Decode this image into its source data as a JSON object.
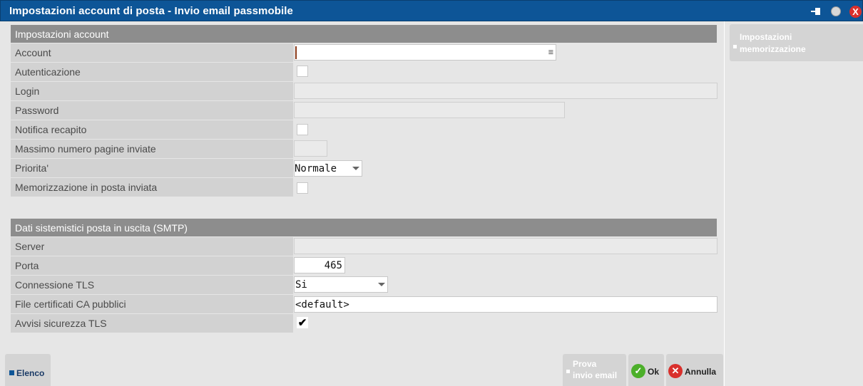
{
  "window": {
    "title": "Impostazioni account di posta - Invio email passmobile",
    "close_glyph": "X"
  },
  "section_account": {
    "title": "Impostazioni account",
    "account_label": "Account",
    "account_value": "",
    "account_menu_glyph": "≡",
    "autenticazione_label": "Autenticazione",
    "autenticazione_checked": false,
    "login_label": "Login",
    "login_value": "",
    "password_label": "Password",
    "password_value": "",
    "notifica_label": "Notifica recapito",
    "notifica_checked": false,
    "massimo_label": "Massimo numero pagine inviate",
    "massimo_value": "",
    "priorita_label": "Priorita'",
    "priorita_value": "Normale",
    "memorizzazione_label": "Memorizzazione in posta inviata",
    "memorizzazione_checked": false
  },
  "section_smtp": {
    "title": "Dati sistemistici posta in uscita (SMTP)",
    "server_label": "Server",
    "server_value": "",
    "porta_label": "Porta",
    "porta_value": "465",
    "tls_label": "Connessione TLS",
    "tls_value": "Si",
    "certificati_label": "File certificati CA pubblici",
    "certificati_value": "<default>",
    "avvisi_label": "Avvisi sicurezza TLS",
    "avvisi_glyph": "✔"
  },
  "sidebar": {
    "impostazioni_line1": "Impostazioni",
    "impostazioni_line2": "memorizzazione"
  },
  "bottom_bar": {
    "elenco_label": "Elenco",
    "prova_line1": "Prova",
    "prova_line2": "invio email",
    "ok_label": "Ok",
    "ok_glyph": "✓",
    "annulla_label": "Annulla",
    "annulla_glyph": "✕"
  }
}
